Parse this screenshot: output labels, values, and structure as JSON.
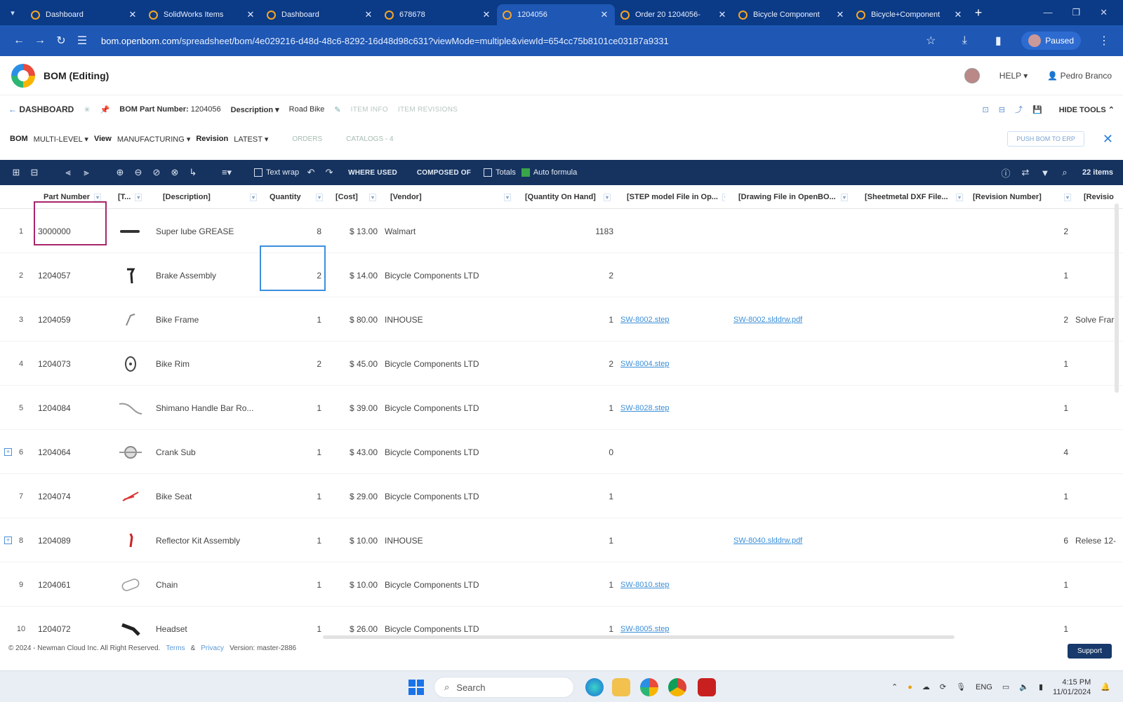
{
  "browser": {
    "tabs": [
      {
        "title": "Dashboard",
        "active": false
      },
      {
        "title": "SolidWorks Items",
        "active": false
      },
      {
        "title": "Dashboard",
        "active": false
      },
      {
        "title": "678678",
        "active": false
      },
      {
        "title": "1204056",
        "active": true
      },
      {
        "title": "Order 20 1204056-",
        "active": false
      },
      {
        "title": "Bicycle Component",
        "active": false
      },
      {
        "title": "Bicycle+Component",
        "active": false
      }
    ],
    "url_host": "bom.openbom.com",
    "url_path": "/spreadsheet/bom/4e029216-d48d-48c6-8292-16d48d98c631?viewMode=multiple&viewId=654cc75b8101ce03187a9331",
    "profile_label": "Paused"
  },
  "app": {
    "title": "BOM (Editing)",
    "help_label": "HELP",
    "user_name": "Pedro Branco"
  },
  "crumbs": {
    "back_label": "DASHBOARD",
    "part_number_label": "BOM Part Number:",
    "part_number_value": "1204056",
    "description_label": "Description",
    "description_value": "Road Bike",
    "item_info": "ITEM INFO",
    "item_revisions": "ITEM REVISIONS",
    "hide_tools": "HIDE TOOLS"
  },
  "mode": {
    "bom_label": "BOM",
    "bom_value": "MULTI-LEVEL",
    "view_label": "View",
    "view_value": "MANUFACTURING",
    "revision_label": "Revision",
    "revision_value": "LATEST",
    "orders": "ORDERS",
    "catalogs": "CATALOGS - 4",
    "push_button": "PUSH BOM TO ERP"
  },
  "toolbar": {
    "text_wrap": "Text wrap",
    "where_used": "WHERE USED",
    "composed_of": "COMPOSED OF",
    "totals": "Totals",
    "auto_formula": "Auto formula",
    "items_count": "22 items"
  },
  "columns": {
    "part_number": "Part Number",
    "thumb": "[T...",
    "description": "[Description]",
    "quantity": "Quantity",
    "cost": "[Cost]",
    "vendor": "[Vendor]",
    "qoh": "[Quantity On Hand]",
    "step": "[STEP model File in Op...",
    "drawing": "[Drawing File in OpenBO...",
    "dxf": "[Sheetmetal DXF File...",
    "revnum": "[Revision Number]",
    "rev2": "[Revisio"
  },
  "rows": [
    {
      "n": "1",
      "part": "3000000",
      "desc": "Super lube GREASE",
      "qty": "8",
      "cost": "$ 13.00",
      "vendor": "Walmart",
      "qoh": "1183",
      "step": "",
      "drawing": "",
      "rev": "2",
      "rev2": "",
      "expand": false
    },
    {
      "n": "2",
      "part": "1204057",
      "desc": "Brake Assembly",
      "qty": "2",
      "cost": "$ 14.00",
      "vendor": "Bicycle Components LTD",
      "qoh": "2",
      "step": "",
      "drawing": "",
      "rev": "1",
      "rev2": "",
      "expand": false
    },
    {
      "n": "3",
      "part": "1204059",
      "desc": "Bike Frame",
      "qty": "1",
      "cost": "$ 80.00",
      "vendor": "INHOUSE",
      "qoh": "1",
      "step": "SW-8002.step",
      "drawing": "SW-8002.slddrw.pdf",
      "rev": "2",
      "rev2": "Solve Frar",
      "expand": false
    },
    {
      "n": "4",
      "part": "1204073",
      "desc": "Bike Rim",
      "qty": "2",
      "cost": "$ 45.00",
      "vendor": "Bicycle Components LTD",
      "qoh": "2",
      "step": "SW-8004.step",
      "drawing": "",
      "rev": "1",
      "rev2": "",
      "expand": false
    },
    {
      "n": "5",
      "part": "1204084",
      "desc": "Shimano Handle Bar Ro...",
      "qty": "1",
      "cost": "$ 39.00",
      "vendor": "Bicycle Components LTD",
      "qoh": "1",
      "step": "SW-8028.step",
      "drawing": "",
      "rev": "1",
      "rev2": "",
      "expand": false
    },
    {
      "n": "6",
      "part": "1204064",
      "desc": "Crank Sub",
      "qty": "1",
      "cost": "$ 43.00",
      "vendor": "Bicycle Components LTD",
      "qoh": "0",
      "step": "",
      "drawing": "",
      "rev": "4",
      "rev2": "",
      "expand": true
    },
    {
      "n": "7",
      "part": "1204074",
      "desc": "Bike Seat",
      "qty": "1",
      "cost": "$ 29.00",
      "vendor": "Bicycle Components LTD",
      "qoh": "1",
      "step": "",
      "drawing": "",
      "rev": "1",
      "rev2": "",
      "expand": false
    },
    {
      "n": "8",
      "part": "1204089",
      "desc": "Reflector Kit Assembly",
      "qty": "1",
      "cost": "$ 10.00",
      "vendor": "INHOUSE",
      "qoh": "1",
      "step": "",
      "drawing": "SW-8040.slddrw.pdf",
      "rev": "6",
      "rev2": "Relese 12-",
      "expand": true
    },
    {
      "n": "9",
      "part": "1204061",
      "desc": "Chain",
      "qty": "1",
      "cost": "$ 10.00",
      "vendor": "Bicycle Components LTD",
      "qoh": "1",
      "step": "SW-8010.step",
      "drawing": "",
      "rev": "1",
      "rev2": "",
      "expand": false
    },
    {
      "n": "10",
      "part": "1204072",
      "desc": "Headset",
      "qty": "1",
      "cost": "$ 26.00",
      "vendor": "Bicycle Components LTD",
      "qoh": "1",
      "step": "SW-8005.step",
      "drawing": "",
      "rev": "1",
      "rev2": "",
      "expand": false
    }
  ],
  "footer": {
    "copyright": "© 2024 - Newman Cloud Inc. All Right Reserved.",
    "terms": "Terms",
    "amp": "&",
    "privacy": "Privacy",
    "version": "Version: master-2886",
    "support": "Support"
  },
  "taskbar": {
    "search_placeholder": "Search",
    "lang": "ENG",
    "time": "4:15 PM",
    "date": "11/01/2024"
  }
}
